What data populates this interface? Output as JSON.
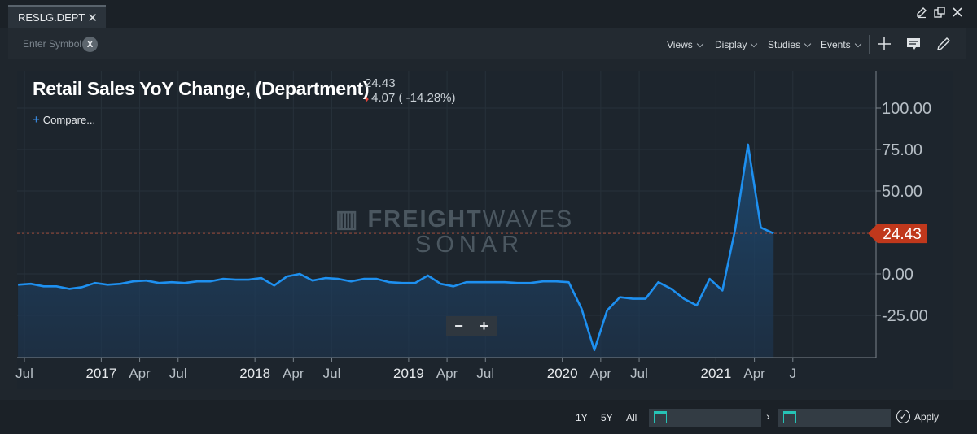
{
  "tab": {
    "label": "RESLG.DEPT",
    "close": "✕"
  },
  "toolbar": {
    "symbol_placeholder": "Enter Symbol",
    "clear_label": "X",
    "menus": [
      "Views",
      "Display",
      "Studies",
      "Events"
    ]
  },
  "header": {
    "title": "Retail Sales YoY Change, (Department)",
    "last_value": "24.43",
    "change": "4.07 ( -14.28%)",
    "change_direction": "down",
    "compare_label": "Compare..."
  },
  "watermark": {
    "line1_bold": "FREIGHT",
    "line1_thin": "WAVES",
    "line2": "SONAR"
  },
  "zoom": {
    "minus": "−",
    "plus": "+"
  },
  "colors": {
    "line": "#1e90f0",
    "price_tag": "#c0381c",
    "area_top": "#1d4a72"
  },
  "chart_data": {
    "type": "area",
    "title": "Retail Sales YoY Change, (Department)",
    "y_ticks": [
      "100.00",
      "75.00",
      "50.00",
      "25.00",
      "0.00",
      "-25.00"
    ],
    "y_tick_values": [
      100,
      75,
      50,
      25,
      0,
      -25
    ],
    "ylim": [
      -50,
      110
    ],
    "x_ticks": [
      {
        "label": "Jul",
        "t": 0
      },
      {
        "label": "2017",
        "t": 6,
        "major": true
      },
      {
        "label": "Apr",
        "t": 9
      },
      {
        "label": "Jul",
        "t": 12
      },
      {
        "label": "2018",
        "t": 18,
        "major": true
      },
      {
        "label": "Apr",
        "t": 21
      },
      {
        "label": "Jul",
        "t": 24
      },
      {
        "label": "2019",
        "t": 30,
        "major": true
      },
      {
        "label": "Apr",
        "t": 33
      },
      {
        "label": "Jul",
        "t": 36
      },
      {
        "label": "2020",
        "t": 42,
        "major": true
      },
      {
        "label": "Apr",
        "t": 45
      },
      {
        "label": "Jul",
        "t": 48
      },
      {
        "label": "2021",
        "t": 54,
        "major": true
      },
      {
        "label": "Apr",
        "t": 57
      },
      {
        "label": "J",
        "t": 60
      }
    ],
    "series": [
      {
        "values": [
          [
            -0.5,
            -6.5
          ],
          [
            0.5,
            -6
          ],
          [
            1.5,
            -7.5
          ],
          [
            2.5,
            -7.5
          ],
          [
            3.5,
            -9
          ],
          [
            4.5,
            -8
          ],
          [
            5.5,
            -5.5
          ],
          [
            6.5,
            -6.5
          ],
          [
            7.5,
            -6
          ],
          [
            8.5,
            -4.5
          ],
          [
            9.5,
            -4
          ],
          [
            10.5,
            -5.5
          ],
          [
            11.5,
            -5
          ],
          [
            12.5,
            -5.5
          ],
          [
            13.5,
            -4.5
          ],
          [
            14.5,
            -4.5
          ],
          [
            15.5,
            -3
          ],
          [
            16.5,
            -3.5
          ],
          [
            17.5,
            -3.5
          ],
          [
            18.5,
            -2.5
          ],
          [
            19.5,
            -7
          ],
          [
            20.5,
            -1.5
          ],
          [
            21.5,
            0
          ],
          [
            22.5,
            -4
          ],
          [
            23.5,
            -2.5
          ],
          [
            24.5,
            -3
          ],
          [
            25.5,
            -4.5
          ],
          [
            26.5,
            -3
          ],
          [
            27.5,
            -3
          ],
          [
            28.5,
            -5
          ],
          [
            29.5,
            -5.5
          ],
          [
            30.5,
            -5.5
          ],
          [
            31.5,
            -1
          ],
          [
            32.5,
            -6
          ],
          [
            33.5,
            -7.5
          ],
          [
            34.5,
            -5
          ],
          [
            35.5,
            -5
          ],
          [
            36.5,
            -5
          ],
          [
            37.5,
            -5
          ],
          [
            38.5,
            -5.5
          ],
          [
            39.5,
            -5.5
          ],
          [
            40.5,
            -4.5
          ],
          [
            41.5,
            -4.5
          ],
          [
            42.5,
            -5
          ],
          [
            43.5,
            -21
          ],
          [
            44.5,
            -46
          ],
          [
            45.5,
            -22
          ],
          [
            46.5,
            -14
          ],
          [
            47.5,
            -15
          ],
          [
            48.5,
            -15
          ],
          [
            49.5,
            -5
          ],
          [
            50.5,
            -9
          ],
          [
            51.5,
            -15
          ],
          [
            52.5,
            -19
          ],
          [
            53.5,
            -3
          ],
          [
            54.5,
            -10
          ],
          [
            55.5,
            27
          ],
          [
            56.5,
            78
          ],
          [
            57.5,
            28
          ],
          [
            58.5,
            24.43
          ]
        ]
      }
    ],
    "last_price": "24.43"
  },
  "bottom": {
    "ranges": [
      "1Y",
      "5Y",
      "All"
    ],
    "apply": "Apply"
  }
}
